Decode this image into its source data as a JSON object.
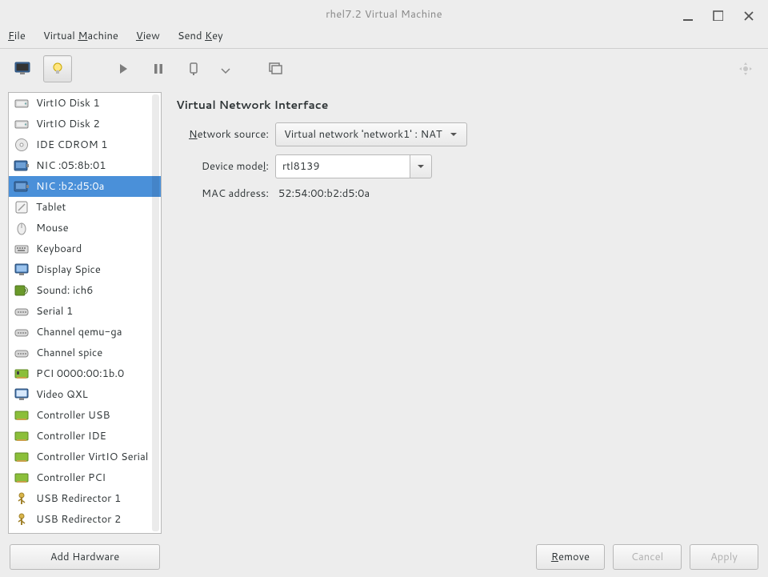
{
  "window": {
    "title": "rhel7.2 Virtual Machine"
  },
  "menubar": {
    "file": "File",
    "virtual_machine": "Virtual Machine",
    "view": "View",
    "send_key": "Send Key"
  },
  "sidebar": {
    "items": [
      {
        "icon": "disk",
        "label": "VirtIO Disk 1"
      },
      {
        "icon": "disk",
        "label": "VirtIO Disk 2"
      },
      {
        "icon": "cd",
        "label": "IDE CDROM 1"
      },
      {
        "icon": "nic",
        "label": "NIC :05:8b:01"
      },
      {
        "icon": "nic",
        "label": "NIC :b2:d5:0a",
        "selected": true
      },
      {
        "icon": "tablet",
        "label": "Tablet"
      },
      {
        "icon": "mouse",
        "label": "Mouse"
      },
      {
        "icon": "keyboard",
        "label": "Keyboard"
      },
      {
        "icon": "display",
        "label": "Display Spice"
      },
      {
        "icon": "sound",
        "label": "Sound: ich6"
      },
      {
        "icon": "serial",
        "label": "Serial 1"
      },
      {
        "icon": "serial",
        "label": "Channel qemu-ga"
      },
      {
        "icon": "serial",
        "label": "Channel spice"
      },
      {
        "icon": "pci",
        "label": "PCI 0000:00:1b.0"
      },
      {
        "icon": "video",
        "label": "Video QXL"
      },
      {
        "icon": "controller",
        "label": "Controller USB"
      },
      {
        "icon": "controller",
        "label": "Controller IDE"
      },
      {
        "icon": "controller",
        "label": "Controller VirtIO Serial"
      },
      {
        "icon": "controller",
        "label": "Controller PCI"
      },
      {
        "icon": "usb",
        "label": "USB Redirector 1"
      },
      {
        "icon": "usb",
        "label": "USB Redirector 2"
      }
    ]
  },
  "details": {
    "heading": "Virtual Network Interface",
    "network_source_label": "Network source:",
    "network_source_value": "Virtual network 'network1' : NAT",
    "device_model_label": "Device model:",
    "device_model_value": "rtl8139",
    "mac_label": "MAC address:",
    "mac_value": "52:54:00:b2:d5:0a"
  },
  "buttons": {
    "add_hardware": "Add Hardware",
    "remove": "Remove",
    "cancel": "Cancel",
    "apply": "Apply"
  }
}
